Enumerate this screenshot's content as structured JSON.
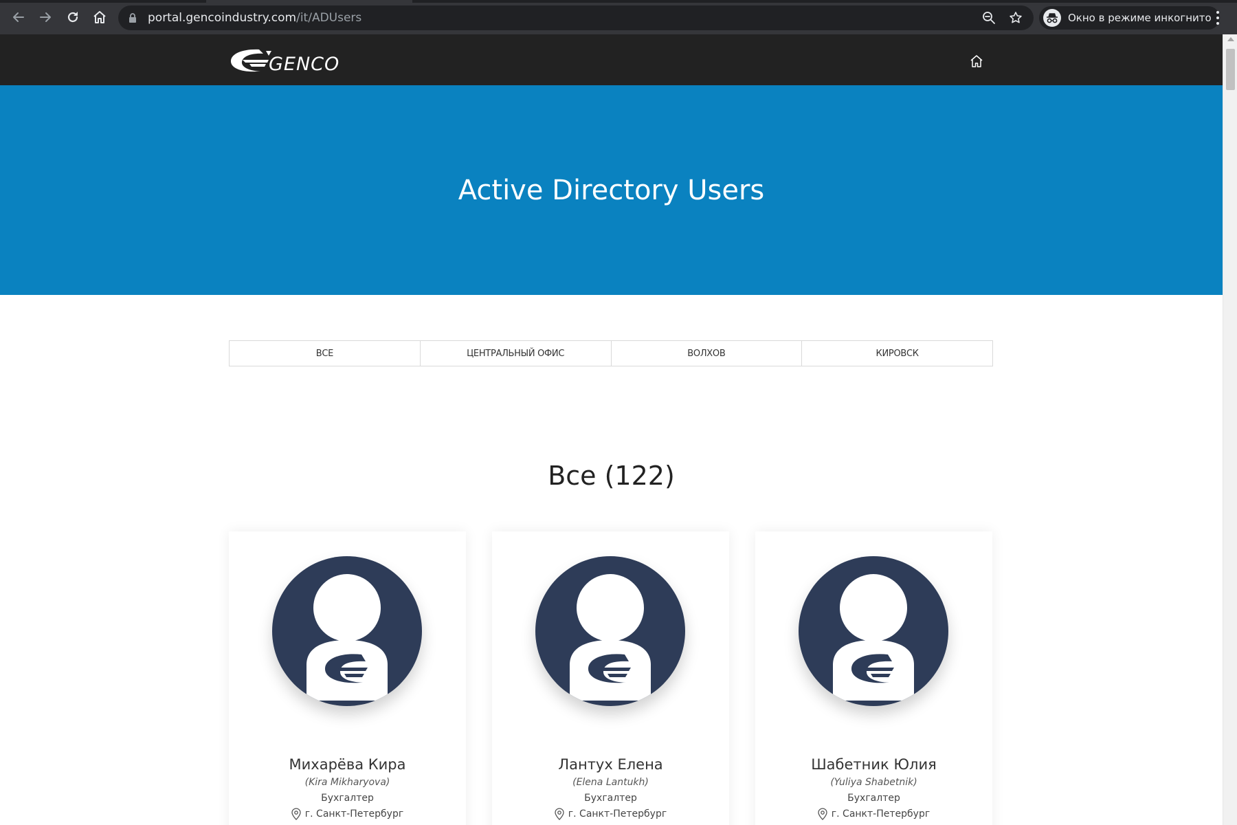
{
  "browser": {
    "url_host": "portal.gencoindustry.com",
    "url_path": "/it/ADUsers",
    "incognito_label": "Окно в режиме инкогнито",
    "icons": [
      "back-arrow-icon",
      "forward-arrow-icon",
      "reload-icon",
      "home-icon",
      "lock-icon",
      "zoom-icon",
      "bookmark-star-icon",
      "incognito-icon",
      "menu-dots-icon"
    ]
  },
  "header": {
    "logo_text": "GENCO",
    "home_icon": "home-icon"
  },
  "hero": {
    "title": "Active Directory Users",
    "background": "#0a82c0"
  },
  "filters": {
    "tabs": [
      {
        "label": "ВСЕ"
      },
      {
        "label": "ЦЕНТРАЛЬНЫЙ ОФИС"
      },
      {
        "label": "ВОЛХОВ"
      },
      {
        "label": "КИРОВСК"
      }
    ]
  },
  "section": {
    "title": "Все (122)"
  },
  "users": [
    {
      "name": "Михарёва Кира",
      "latin": "(Kira Mikharyova)",
      "role": "Бухгалтер",
      "location": "г. Санкт-Петербург"
    },
    {
      "name": "Лантух Елена",
      "latin": "(Elena Lantukh)",
      "role": "Бухгалтер",
      "location": "г. Санкт-Петербург"
    },
    {
      "name": "Шабетник Юлия",
      "latin": "(Yuliya Shabetnik)",
      "role": "Бухгалтер",
      "location": "г. Санкт-Петербург"
    }
  ],
  "colors": {
    "header_bar": "#222222",
    "avatar_bg": "#2e3c58",
    "chrome_bg": "#35363a"
  }
}
